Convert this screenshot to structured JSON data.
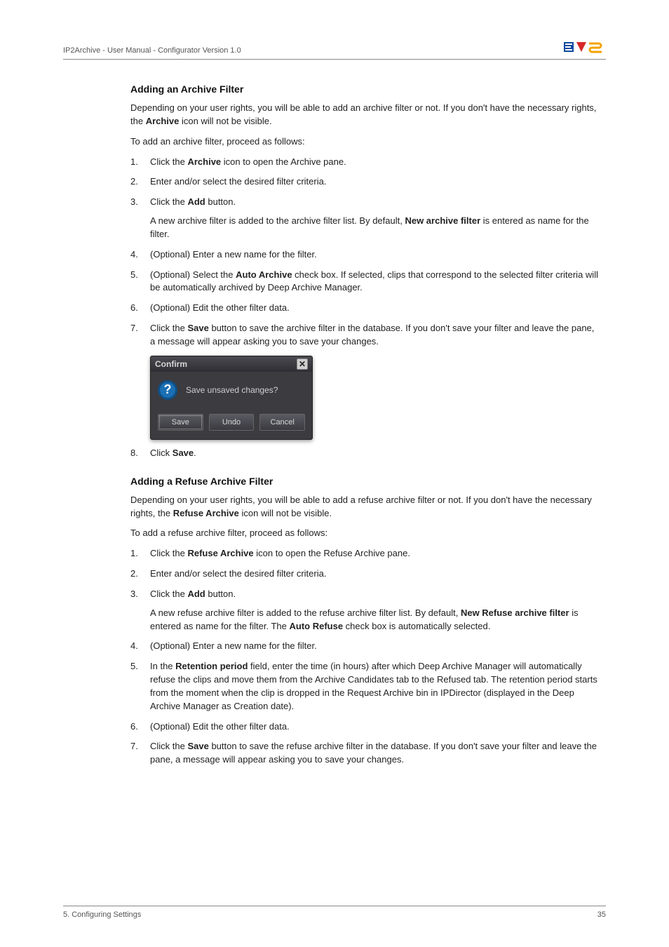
{
  "header": {
    "left": "IP2Archive - User Manual - Configurator Version 1.0"
  },
  "section1": {
    "heading": "Adding an Archive Filter",
    "intro1": "Depending on your user rights, you will be able to add an archive filter or not. If you don't have the necessary rights, the ",
    "intro1b": "Archive",
    "intro1c": " icon will not be visible.",
    "lead": "To add an archive filter, proceed as follows:",
    "s1a": "Click the ",
    "s1b": "Archive",
    "s1c": " icon to open the Archive pane.",
    "s2": "Enter and/or select the desired filter criteria.",
    "s3a": "Click the ",
    "s3b": "Add",
    "s3c": " button.",
    "s3body_a": "A new archive filter is added to the archive filter list. By default, ",
    "s3body_b": "New archive filter",
    "s3body_c": " is entered as name for the filter.",
    "s4": "(Optional) Enter a new name for the filter.",
    "s5a": "(Optional) Select the ",
    "s5b": "Auto Archive",
    "s5c": " check box. If selected, clips that correspond to the selected filter criteria will be automatically archived by Deep Archive Manager.",
    "s6": "(Optional) Edit the other filter data.",
    "s7a": "Click the ",
    "s7b": "Save",
    "s7c": " button to save the archive filter in the database. If you don't save your filter and leave the pane, a message will appear asking you to save your changes.",
    "s8a": "Click ",
    "s8b": "Save",
    "s8c": "."
  },
  "dialog": {
    "title": "Confirm",
    "message": "Save unsaved changes?",
    "btn_save": "Save",
    "btn_undo": "Undo",
    "btn_cancel": "Cancel"
  },
  "section2": {
    "heading": "Adding a Refuse Archive Filter",
    "intro1": "Depending on your user rights, you will be able to add a refuse archive filter or not. If you don't have the necessary rights, the ",
    "intro1b": "Refuse Archive",
    "intro1c": " icon will not be visible.",
    "lead": "To add a refuse archive filter, proceed as follows:",
    "s1a": "Click the ",
    "s1b": "Refuse Archive",
    "s1c": " icon to open the Refuse Archive pane.",
    "s2": "Enter and/or select the desired filter criteria.",
    "s3a": "Click the ",
    "s3b": "Add",
    "s3c": " button.",
    "s3body_a": "A new refuse archive filter is added to the refuse archive filter list. By default, ",
    "s3body_b": "New Refuse archive filter",
    "s3body_c": " is entered as name for the filter. The ",
    "s3body_d": "Auto Refuse",
    "s3body_e": " check box is automatically selected.",
    "s4": "(Optional) Enter a new name for the filter.",
    "s5a": "In the ",
    "s5b": "Retention period",
    "s5c": " field, enter the time (in hours) after which Deep Archive Manager will automatically refuse the clips and move them from the Archive Candidates tab to the Refused tab. The retention period starts from the moment when the clip is dropped in the Request Archive bin in IPDirector (displayed in the Deep Archive Manager as Creation date).",
    "s6": "(Optional) Edit the other filter data.",
    "s7a": "Click the ",
    "s7b": "Save",
    "s7c": " button to save the refuse archive filter in the database. If you don't save your filter and leave the pane, a message will appear asking you to save your changes."
  },
  "footer": {
    "left": "5. Configuring Settings",
    "right": "35"
  }
}
